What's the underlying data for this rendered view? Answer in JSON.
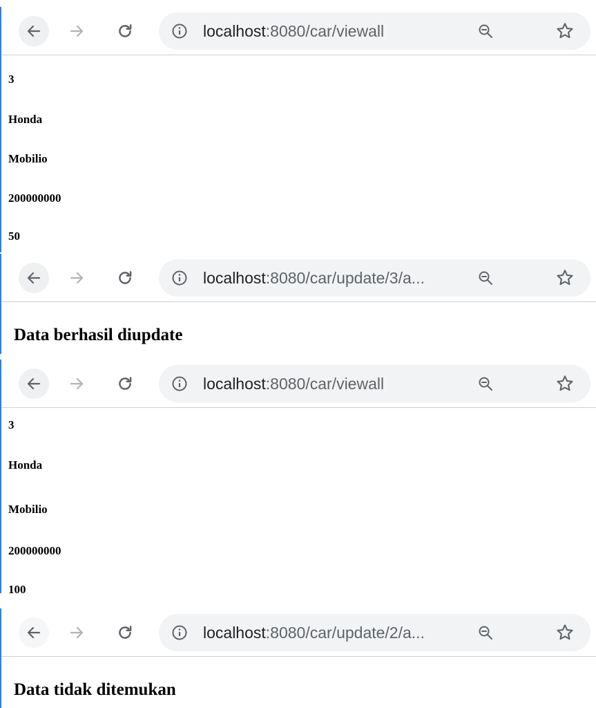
{
  "screens": [
    {
      "url_host": "localhost",
      "url_path": ":8080/car/viewall",
      "fields": [
        "3",
        "Honda",
        "Mobilio",
        "200000000",
        "50"
      ]
    },
    {
      "url_host": "localhost",
      "url_path": ":8080/car/update/3/a...",
      "message": "Data berhasil diupdate"
    },
    {
      "url_host": "localhost",
      "url_path": ":8080/car/viewall",
      "fields": [
        "3",
        "Honda",
        "Mobilio",
        "200000000",
        "100"
      ]
    },
    {
      "url_host": "localhost",
      "url_path": ":8080/car/update/2/a...",
      "message": "Data tidak ditemukan"
    }
  ]
}
